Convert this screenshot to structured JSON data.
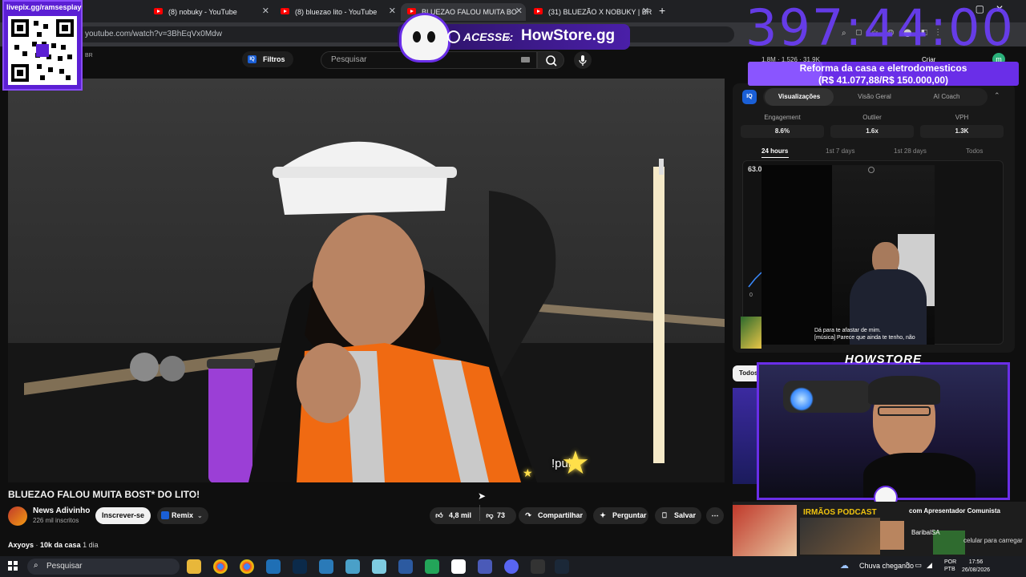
{
  "browser": {
    "tabs": [
      {
        "title": "(8) nobuky - YouTube"
      },
      {
        "title": "(8) bluezao lito - YouTube"
      },
      {
        "title": "BLUEZAO FALOU MUITA BO"
      },
      {
        "title": "(31) BLUEZÃO X NOBUKY | BRI"
      }
    ],
    "url": "youtube.com/watch?v=3BhEqVx0Mdw",
    "toolbar_stats": {
      "a": "1.8M",
      "b": "1.526",
      "c": "31.9K",
      "create": "Criar"
    }
  },
  "youtube": {
    "filtros_label": "Filtros",
    "filtros_badge": "IQ",
    "search_placeholder": "Pesquisar",
    "video": {
      "title": "BLUEZAO FALOU MUITA BOST* DO LITO!",
      "channel": "News Adivinho",
      "subscribers": "226 mil inscritos",
      "subscribe_label": "Inscrever-se",
      "remix_label": "Remix",
      "likes": "4,8 mil",
      "dislikes": "73",
      "share_label": "Compartilhar",
      "ask_label": "Perguntar",
      "save_label": "Salvar"
    },
    "comment": {
      "author": "Axyoys",
      "text": "10k da casa",
      "age": "1 dia"
    },
    "panel": {
      "logo": "IQ",
      "tabs": [
        "Visualizações",
        "Visão Geral",
        "AI Coach"
      ],
      "metrics": [
        {
          "label": "Engagement",
          "value": "8.6%"
        },
        {
          "label": "Outlier",
          "value": "1.6x"
        },
        {
          "label": "VPH",
          "value": "1.3K"
        }
      ],
      "ranges": [
        "24 hours",
        "1st 7 days",
        "1st 28 days",
        "Todos"
      ],
      "chart_top": "63.0",
      "chart_zero": "0"
    },
    "todos_label": "Todos"
  },
  "overlay": {
    "qr_label": "livepix.gg/ramsesplay",
    "timer": "397:44:00",
    "goal_title": "Reforma da casa e eletrodomesticos",
    "goal_progress": "(R$ 41.077,88/R$ 150.000,00)",
    "goal_fraction": 0.2739,
    "banner_acesse": "ACESSE:",
    "banner_site": "HowStore.gg",
    "howstore_logo": "HOWSTORE",
    "caption_line1": "Dá para te afastar de mim.",
    "caption_line2": "[música] Parece que ainda te tenho, não",
    "pula": "!pula",
    "podcast_title": "IRMÃOS PODCAST",
    "podcast_label": "com Apresentador Comunista",
    "baribal": "BaribalSA",
    "pula_car": "celular para carregar"
  },
  "taskbar": {
    "search_placeholder": "Pesquisar",
    "weather": "Chuva chegando",
    "lang1": "POR",
    "lang2": "PTB",
    "time": "17:56",
    "date": "26/08/2026"
  },
  "colors": {
    "youtube_red": "#ff0000",
    "overlay_purple": "#6a2ee8",
    "timer_purple": "#6a3df5",
    "page_bg": "#0f0f0f"
  }
}
